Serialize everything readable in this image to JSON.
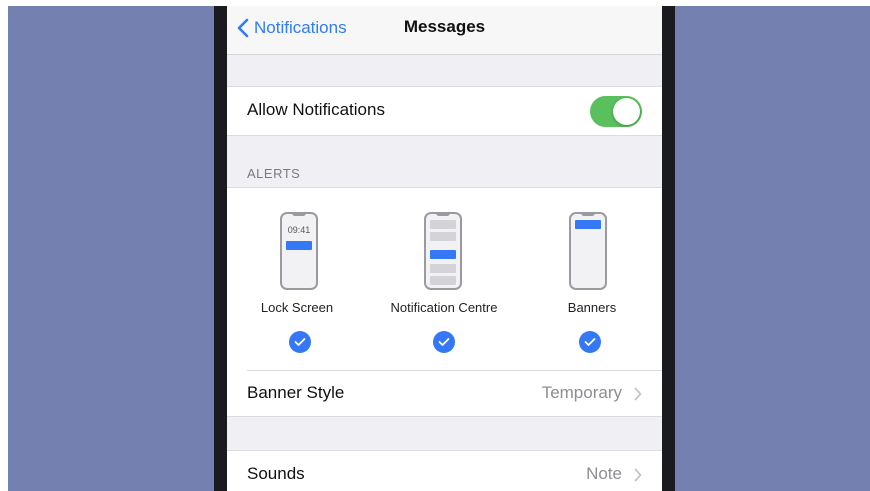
{
  "navbar": {
    "back_label": "Notifications",
    "title": "Messages"
  },
  "allow": {
    "label": "Allow Notifications",
    "enabled": true,
    "toggle_color": "#5ac05d"
  },
  "alerts": {
    "header": "ALERTS",
    "options": [
      {
        "label": "Lock Screen",
        "preview_time": "09:41",
        "checked": true
      },
      {
        "label": "Notification Centre",
        "checked": true
      },
      {
        "label": "Banners",
        "checked": true
      }
    ],
    "check_color": "#3478f6"
  },
  "banner_style": {
    "label": "Banner Style",
    "value": "Temporary"
  },
  "sounds": {
    "label": "Sounds",
    "value": "Note"
  },
  "colors": {
    "accent": "#2f7cf6",
    "backdrop": "#7480b0"
  }
}
